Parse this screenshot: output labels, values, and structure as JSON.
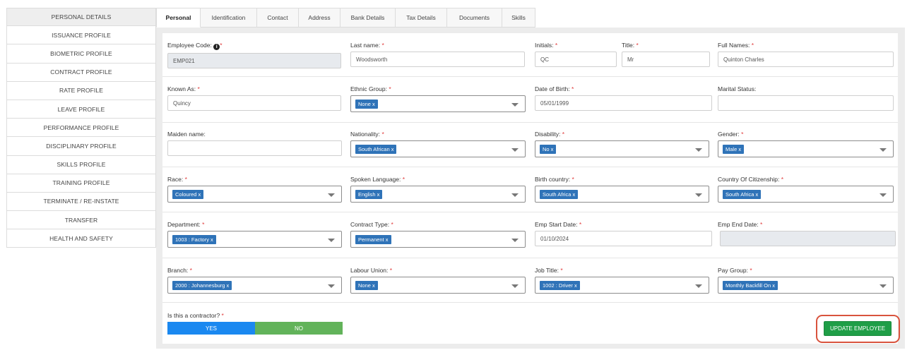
{
  "sidebar": {
    "items": [
      {
        "label": "PERSONAL DETAILS"
      },
      {
        "label": "ISSUANCE PROFILE"
      },
      {
        "label": "BIOMETRIC PROFILE"
      },
      {
        "label": "CONTRACT PROFILE"
      },
      {
        "label": "RATE PROFILE"
      },
      {
        "label": "LEAVE PROFILE"
      },
      {
        "label": "PERFORMANCE PROFILE"
      },
      {
        "label": "DISCIPLINARY PROFILE"
      },
      {
        "label": "SKILLS PROFILE"
      },
      {
        "label": "TRAINING PROFILE"
      },
      {
        "label": "TERMINATE / RE-INSTATE"
      },
      {
        "label": "TRANSFER"
      },
      {
        "label": "HEALTH AND SAFETY"
      }
    ]
  },
  "tabs": [
    {
      "label": "Personal"
    },
    {
      "label": "Identification"
    },
    {
      "label": "Contact"
    },
    {
      "label": "Address"
    },
    {
      "label": "Bank Details"
    },
    {
      "label": "Tax Details"
    },
    {
      "label": "Documents"
    },
    {
      "label": "Skills"
    }
  ],
  "form": {
    "employee_code": {
      "label": "Employee Code:",
      "value": "EMP021"
    },
    "last_name": {
      "label": "Last name:",
      "value": "Woodsworth"
    },
    "initials": {
      "label": "Initials:",
      "value": "QC"
    },
    "title": {
      "label": "Title:",
      "value": "Mr"
    },
    "full_names": {
      "label": "Full Names:",
      "value": "Quinton Charles"
    },
    "known_as": {
      "label": "Known As:",
      "value": "Quincy"
    },
    "ethnic_group": {
      "label": "Ethnic Group:",
      "value": "None x"
    },
    "date_of_birth": {
      "label": "Date of Birth:",
      "value": "05/01/1999"
    },
    "marital_status": {
      "label": "Marital Status:",
      "value": ""
    },
    "maiden_name": {
      "label": "Maiden name:",
      "value": ""
    },
    "nationality": {
      "label": "Nationality:",
      "value": "South African x"
    },
    "disability": {
      "label": "Disability:",
      "value": "No x"
    },
    "gender": {
      "label": "Gender:",
      "value": "Male x"
    },
    "race": {
      "label": "Race:",
      "value": "Coloured x"
    },
    "spoken_language": {
      "label": "Spoken Language:",
      "value": "English x"
    },
    "birth_country": {
      "label": "Birth country:",
      "value": "South Africa x"
    },
    "country_of_citizenship": {
      "label": "Country Of Citizenship:",
      "value": "South Africa x"
    },
    "department": {
      "label": "Department:",
      "value": "1003 : Factory x"
    },
    "contract_type": {
      "label": "Contract Type:",
      "value": "Permanent x"
    },
    "emp_start_date": {
      "label": "Emp Start Date:",
      "value": "01/10/2024"
    },
    "emp_end_date": {
      "label": "Emp End Date:",
      "value": ""
    },
    "branch": {
      "label": "Branch:",
      "value": "2000 : Johannesburg x"
    },
    "labour_union": {
      "label": "Labour Union:",
      "value": "None x"
    },
    "job_title": {
      "label": "Job Title:",
      "value": "1002 : Driver x"
    },
    "pay_group": {
      "label": "Pay Group:",
      "value": "Monthly Backfill On x"
    },
    "contractor": {
      "label": "Is this a contractor?",
      "yes": "YES",
      "no": "NO"
    }
  },
  "required_mark": "*",
  "info_glyph": "i",
  "update_button": "UPDATE EMPLOYEE",
  "colors": {
    "tag": "#2f73b8",
    "yes": "#1a88f0",
    "no": "#62b35a",
    "update": "#1f9e47",
    "highlight": "#d9533d"
  }
}
